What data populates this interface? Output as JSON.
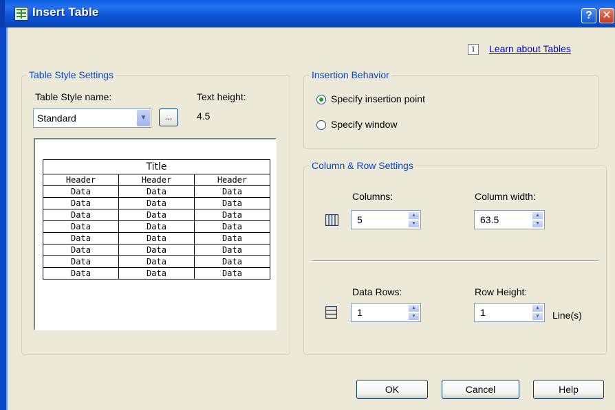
{
  "window": {
    "title": "Insert Table"
  },
  "help_link": {
    "text": "Learn about Tables"
  },
  "table_style": {
    "group_title": "Table Style Settings",
    "style_name_label": "Table Style name:",
    "style_name_value": "Standard",
    "text_height_label": "Text height:",
    "text_height_value": "4.5",
    "browse_label": "...",
    "preview": {
      "title": "Title",
      "headers": [
        "Header",
        "Header",
        "Header"
      ],
      "rows": [
        [
          "Data",
          "Data",
          "Data"
        ],
        [
          "Data",
          "Data",
          "Data"
        ],
        [
          "Data",
          "Data",
          "Data"
        ],
        [
          "Data",
          "Data",
          "Data"
        ],
        [
          "Data",
          "Data",
          "Data"
        ],
        [
          "Data",
          "Data",
          "Data"
        ],
        [
          "Data",
          "Data",
          "Data"
        ],
        [
          "Data",
          "Data",
          "Data"
        ]
      ]
    }
  },
  "insertion": {
    "group_title": "Insertion Behavior",
    "options": [
      "Specify insertion point",
      "Specify window"
    ],
    "selected": "Specify insertion point"
  },
  "col_row": {
    "group_title": "Column & Row Settings",
    "columns_label": "Columns:",
    "columns_value": "5",
    "column_width_label": "Column width:",
    "column_width_value": "63.5",
    "data_rows_label": "Data Rows:",
    "data_rows_value": "1",
    "row_height_label": "Row Height:",
    "row_height_value": "1",
    "row_height_unit": "Line(s)"
  },
  "buttons": {
    "ok": "OK",
    "cancel": "Cancel",
    "help": "Help"
  },
  "colors": {
    "titlebar": "#0b54d6",
    "group_title": "#0046d5",
    "link": "#0000cc",
    "radio_dot": "#21a121"
  }
}
